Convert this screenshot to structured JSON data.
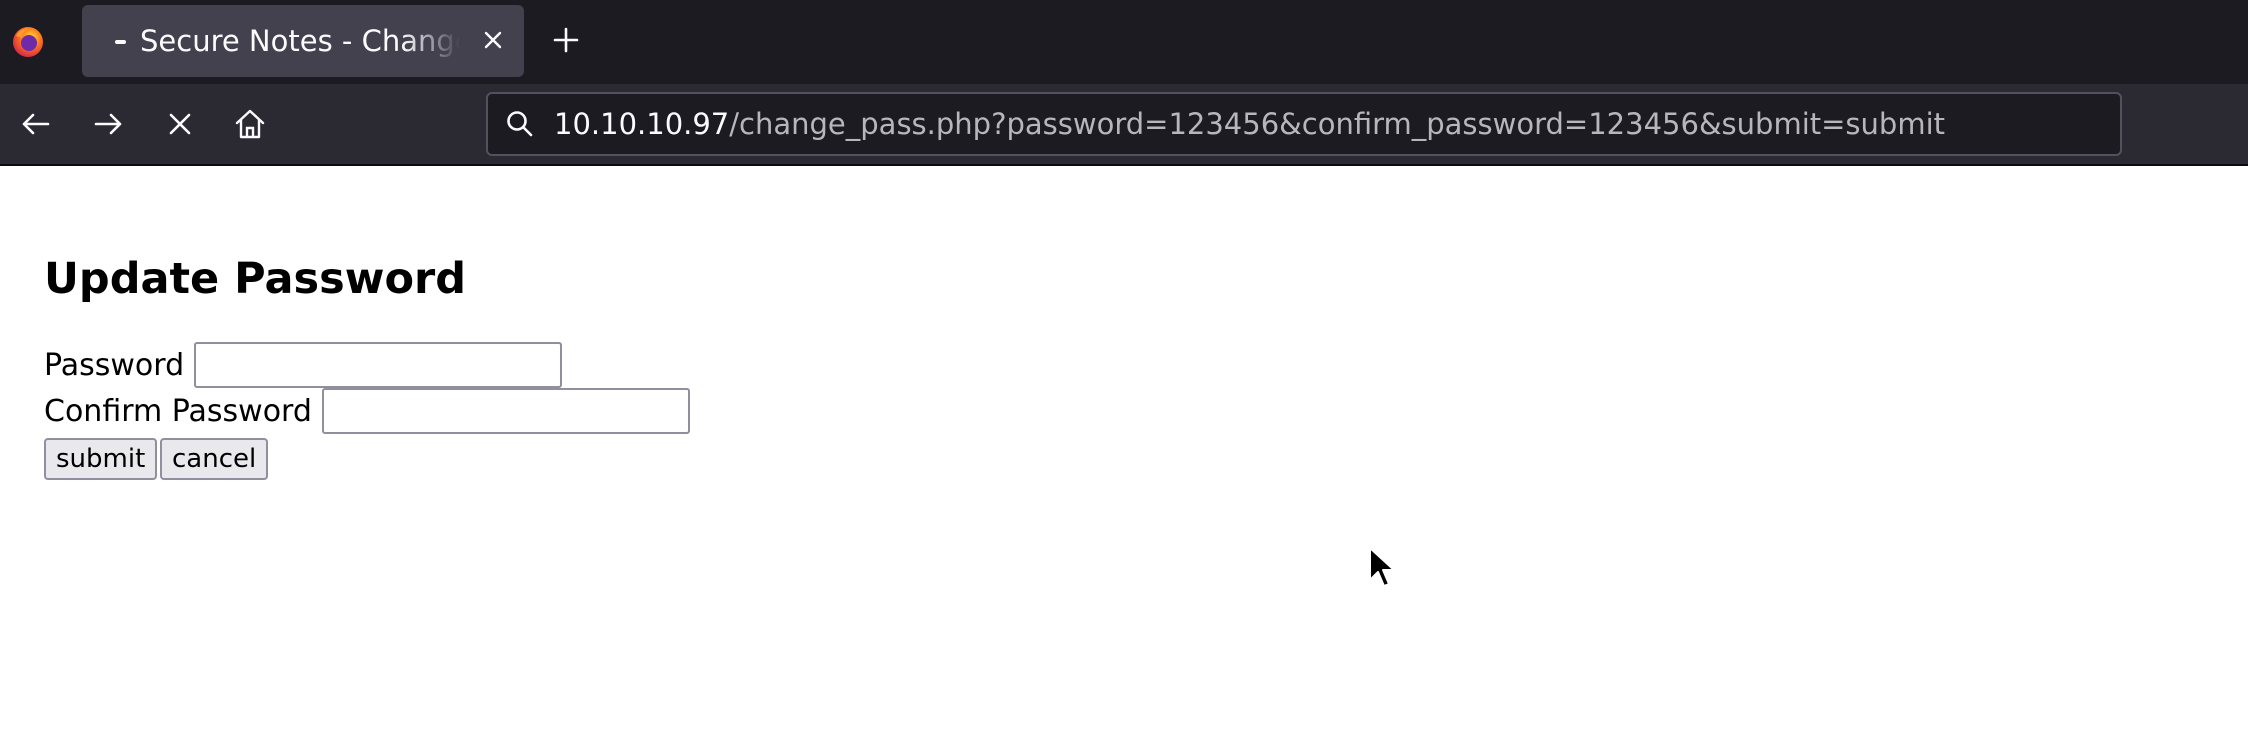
{
  "browser": {
    "tab": {
      "title": "Secure Notes - Change Password"
    },
    "url": {
      "host": "10.10.10.97",
      "path": "/change_pass.php?password=123456&confirm_password=123456&submit=submit"
    },
    "icons": {
      "logo": "firefox-logo-icon",
      "close_tab": "close-icon",
      "new_tab": "plus-icon",
      "back": "arrow-left-icon",
      "forward": "arrow-right-icon",
      "stop": "stop-x-icon",
      "home": "home-icon",
      "search": "search-icon"
    },
    "colors": {
      "tabbar_bg": "#1c1b22",
      "navbar_bg": "#2b2a33",
      "active_tab_bg": "#42414d",
      "urlbar_bg": "#1c1b22"
    }
  },
  "page": {
    "title": "Update Password",
    "form": {
      "password_label": "Password",
      "password_value": "",
      "confirm_label": "Confirm Password",
      "confirm_value": "",
      "submit_label": "submit",
      "cancel_label": "cancel"
    }
  }
}
